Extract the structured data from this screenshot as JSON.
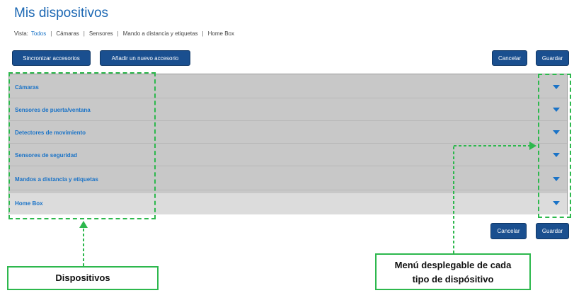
{
  "page": {
    "title": "Mis dispositivos"
  },
  "view_bar": {
    "label": "Vista:",
    "options": [
      "Todos",
      "Cámaras",
      "Sensores",
      "Mando a distancia y etiquetas",
      "Home Box"
    ],
    "separator": "|"
  },
  "toolbar": {
    "sync_label": "Sincronizar accesorios",
    "add_label": "Añadir un nuevo accesorio",
    "cancel_label": "Cancelar",
    "save_label": "Guardar"
  },
  "device_list": {
    "rows": [
      {
        "label": "Cámaras"
      },
      {
        "label": "Sensores de puerta/ventana"
      },
      {
        "label": "Detectores de movimiento"
      },
      {
        "label": "Sensores de seguridad"
      },
      {
        "label": "Mandos a distancia y etiquetas"
      },
      {
        "label": "Home Box"
      }
    ],
    "expand_icon": "chevron-down-icon"
  },
  "annotations": {
    "devices_label": "Dispositivos",
    "dropdown_label_line1": "Menú desplegable de cada",
    "dropdown_label_line2": "tipo de dispósitivo",
    "highlight_color": "#2db84d"
  },
  "colors": {
    "title": "#1b67b3",
    "button": "#1a4f8f",
    "link": "#1a73c7",
    "panel": "#c8c8c8"
  }
}
